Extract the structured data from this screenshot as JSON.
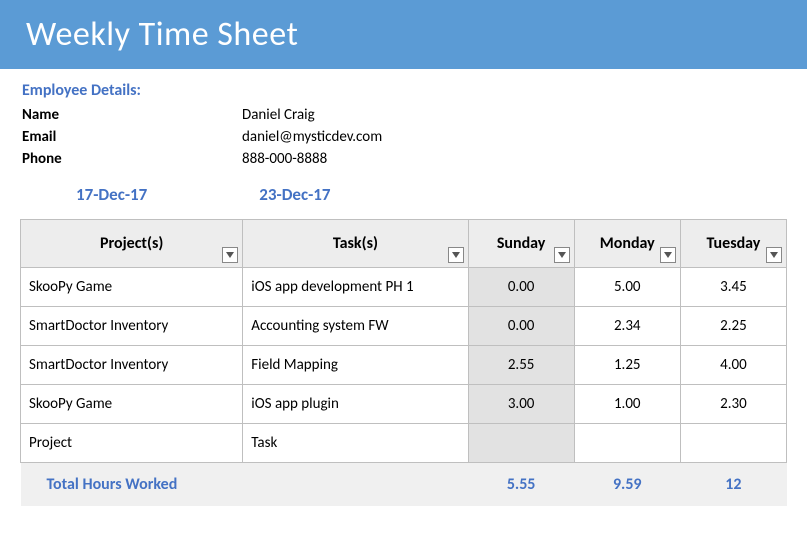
{
  "title": "Weekly Time Sheet",
  "employee": {
    "header": "Employee Details:",
    "name_label": "Name",
    "name": "Daniel Craig",
    "email_label": "Email",
    "email": "daniel@mysticdev.com",
    "phone_label": "Phone",
    "phone": "888-000-8888"
  },
  "dates": {
    "start": "17-Dec-17",
    "end": "23-Dec-17"
  },
  "headers": {
    "project": "Project(s)",
    "task": "Task(s)",
    "sunday": "Sunday",
    "monday": "Monday",
    "tuesday": "Tuesday"
  },
  "rows": [
    {
      "project": "SkooPy Game",
      "task": "iOS app development PH 1",
      "sunday": "0.00",
      "monday": "5.00",
      "tuesday": "3.45"
    },
    {
      "project": "SmartDoctor Inventory",
      "task": "Accounting system FW",
      "sunday": "0.00",
      "monday": "2.34",
      "tuesday": "2.25"
    },
    {
      "project": "SmartDoctor Inventory",
      "task": "Field Mapping",
      "sunday": "2.55",
      "monday": "1.25",
      "tuesday": "4.00"
    },
    {
      "project": "SkooPy Game",
      "task": "iOS app plugin",
      "sunday": "3.00",
      "monday": "1.00",
      "tuesday": "2.30"
    },
    {
      "project": "Project",
      "task": "Task",
      "sunday": "",
      "monday": "",
      "tuesday": ""
    }
  ],
  "totals": {
    "label": "Total Hours Worked",
    "sunday": "5.55",
    "monday": "9.59",
    "tuesday": "12"
  }
}
